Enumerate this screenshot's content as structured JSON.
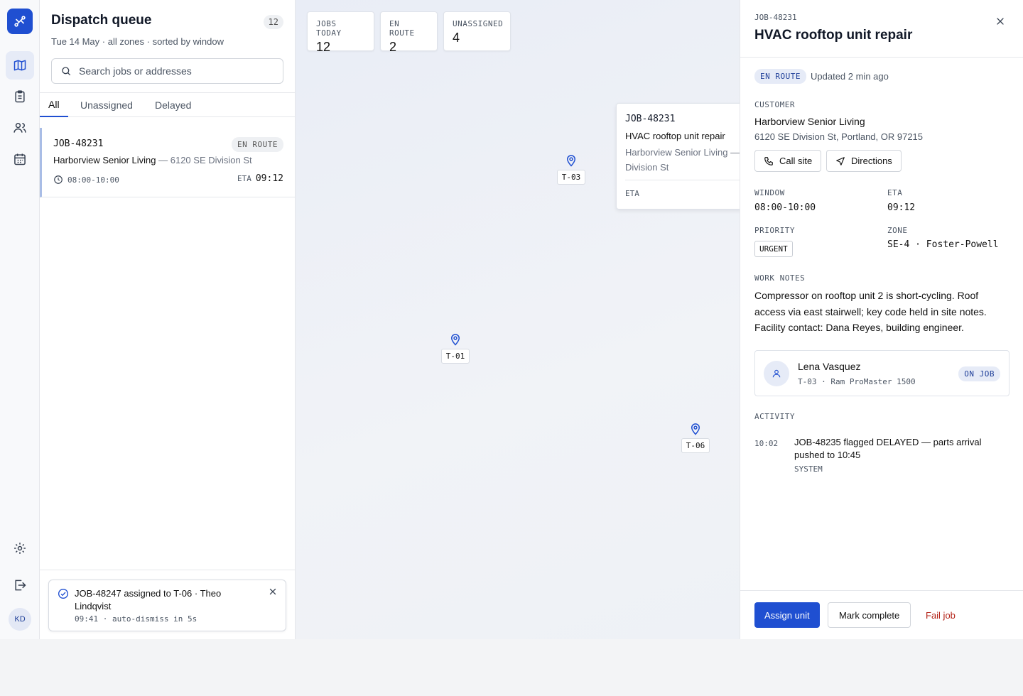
{
  "rail": {
    "avatar_initials": "KD",
    "icons": [
      "route-logo-icon",
      "map-icon",
      "clipboard-icon",
      "users-icon",
      "calendar-icon",
      "gear-icon",
      "logout-icon"
    ]
  },
  "queue": {
    "title": "Dispatch queue",
    "count": "12",
    "subtitle": "Tue 14 May · all zones · sorted by window",
    "search_placeholder": "Search jobs or addresses",
    "tabs": [
      "All",
      "Unassigned",
      "Delayed"
    ],
    "active_tab": "All",
    "jobs": [
      {
        "id": "JOB-48231",
        "status": "EN ROUTE",
        "customer": "Harborview Senior Living",
        "address": " — 6120 SE Division St",
        "window": "08:00-10:00",
        "eta_label": "ETA",
        "eta": "09:12"
      }
    ]
  },
  "toast": {
    "message": "JOB-48247 assigned to T-06 · Theo Lindqvist",
    "meta": "09:41 · auto-dismiss in 5s"
  },
  "map": {
    "stats": [
      {
        "label": "JOBS TODAY",
        "value": "12"
      },
      {
        "label": "EN ROUTE",
        "value": "2"
      },
      {
        "label": "UNASSIGNED",
        "value": "4"
      }
    ],
    "pins": [
      "T-03",
      "T-01",
      "T-06"
    ],
    "popup": {
      "id": "JOB-48231",
      "title": "HVAC rooftop unit repair",
      "address": "Harborview Senior Living — Division St",
      "eta_label": "ETA"
    },
    "accent": "#1f4fd1"
  },
  "detail": {
    "id": "JOB-48231",
    "title": "HVAC rooftop unit repair",
    "status": "EN ROUTE",
    "updated": "Updated 2 min ago",
    "customer_label": "CUSTOMER",
    "customer_name": "Harborview Senior Living",
    "customer_address": "6120 SE Division St, Portland, OR 97215",
    "call_label": "Call site",
    "directions_label": "Directions",
    "window_label": "WINDOW",
    "window": "08:00-10:00",
    "eta_label": "ETA",
    "eta": "09:12",
    "priority_label": "PRIORITY",
    "priority": "URGENT",
    "zone_label": "ZONE",
    "zone": "SE-4 · Foster-Powell",
    "notes_label": "WORK NOTES",
    "notes": "Compressor on rooftop unit 2 is short-cycling. Roof access via east stairwell; key code held in site notes. Facility contact: Dana Reyes, building engineer.",
    "tech": {
      "name": "Lena Vasquez",
      "vehicle": "T-03 · Ram ProMaster 1500",
      "status": "ON JOB"
    },
    "activity_label": "ACTIVITY",
    "activity": [
      {
        "time": "10:02",
        "text": "JOB-48235 flagged DELAYED — parts arrival pushed to 10:45",
        "source": "SYSTEM"
      }
    ],
    "actions": {
      "assign": "Assign unit",
      "complete": "Mark complete",
      "fail": "Fail job"
    }
  }
}
